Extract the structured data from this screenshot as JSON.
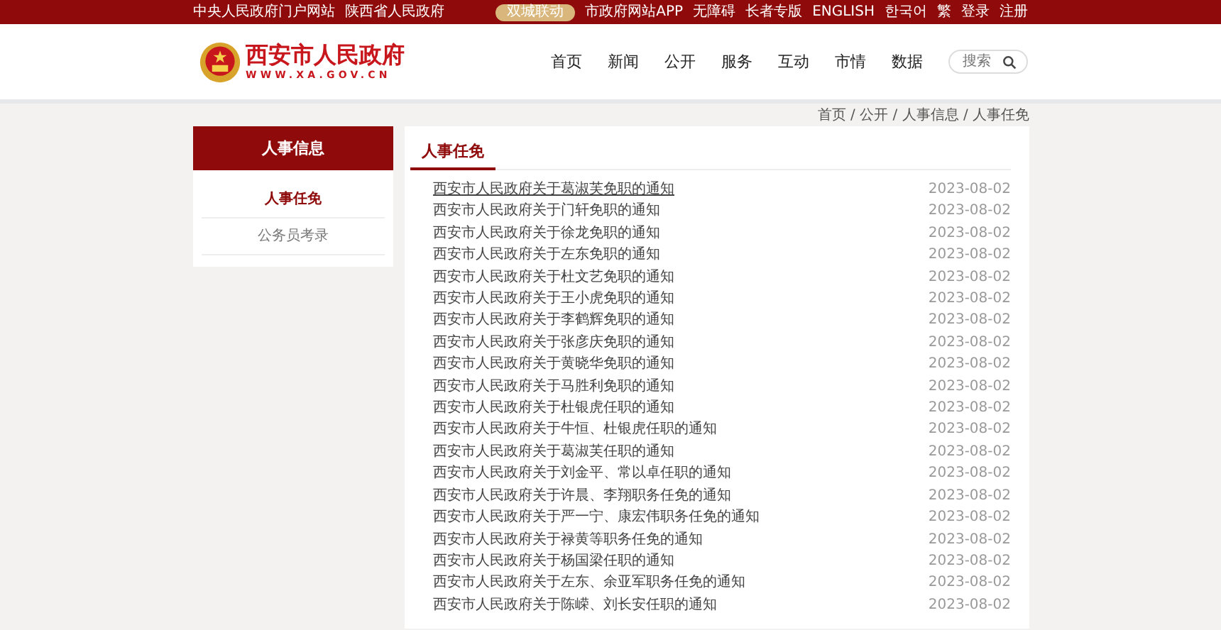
{
  "top_bar": {
    "left_links": [
      "中央人民政府门户网站",
      "陕西省人民政府"
    ],
    "badge": "双城联动",
    "right_links": [
      "市政府网站APP",
      "无障碍",
      "长者专版",
      "ENGLISH",
      "한국어",
      "繁",
      "登录",
      "注册"
    ]
  },
  "header": {
    "site_title": "西安市人民政府",
    "site_url": "WWW.XA.GOV.CN",
    "nav": [
      "首页",
      "新闻",
      "公开",
      "服务",
      "互动",
      "市情",
      "数据"
    ],
    "search": {
      "placeholder": "搜索"
    }
  },
  "breadcrumb": "首页 / 公开 / 人事信息 / 人事任免",
  "sidebar": {
    "title": "人事信息",
    "items": [
      {
        "label": "人事任免",
        "selected": true
      },
      {
        "label": "公务员考录",
        "selected": false
      }
    ]
  },
  "content": {
    "title": "人事任免",
    "rows": [
      {
        "title": "西安市人民政府关于葛淑芙免职的通知",
        "date": "2023-08-02",
        "hovered": true
      },
      {
        "title": "西安市人民政府关于门轩免职的通知",
        "date": "2023-08-02",
        "hovered": false
      },
      {
        "title": "西安市人民政府关于徐龙免职的通知",
        "date": "2023-08-02",
        "hovered": false
      },
      {
        "title": "西安市人民政府关于左东免职的通知",
        "date": "2023-08-02",
        "hovered": false
      },
      {
        "title": "西安市人民政府关于杜文艺免职的通知",
        "date": "2023-08-02",
        "hovered": false
      },
      {
        "title": "西安市人民政府关于王小虎免职的通知",
        "date": "2023-08-02",
        "hovered": false
      },
      {
        "title": "西安市人民政府关于李鹤辉免职的通知",
        "date": "2023-08-02",
        "hovered": false
      },
      {
        "title": "西安市人民政府关于张彦庆免职的通知",
        "date": "2023-08-02",
        "hovered": false
      },
      {
        "title": "西安市人民政府关于黄晓华免职的通知",
        "date": "2023-08-02",
        "hovered": false
      },
      {
        "title": "西安市人民政府关于马胜利免职的通知",
        "date": "2023-08-02",
        "hovered": false
      },
      {
        "title": "西安市人民政府关于杜银虎任职的通知",
        "date": "2023-08-02",
        "hovered": false
      },
      {
        "title": "西安市人民政府关于牛恒、杜银虎任职的通知",
        "date": "2023-08-02",
        "hovered": false
      },
      {
        "title": "西安市人民政府关于葛淑芙任职的通知",
        "date": "2023-08-02",
        "hovered": false
      },
      {
        "title": "西安市人民政府关于刘金平、常以卓任职的通知",
        "date": "2023-08-02",
        "hovered": false
      },
      {
        "title": "西安市人民政府关于许晨、李翔职务任免的通知",
        "date": "2023-08-02",
        "hovered": false
      },
      {
        "title": "西安市人民政府关于严一宁、康宏伟职务任免的通知",
        "date": "2023-08-02",
        "hovered": false
      },
      {
        "title": "西安市人民政府关于禄黄等职务任免的通知",
        "date": "2023-08-02",
        "hovered": false
      },
      {
        "title": "西安市人民政府关于杨国梁任职的通知",
        "date": "2023-08-02",
        "hovered": false
      },
      {
        "title": "西安市人民政府关于左东、余亚军职务任免的通知",
        "date": "2023-08-02",
        "hovered": false
      },
      {
        "title": "西安市人民政府关于陈嵘、刘长安任职的通知",
        "date": "2023-08-02",
        "hovered": false
      }
    ]
  }
}
